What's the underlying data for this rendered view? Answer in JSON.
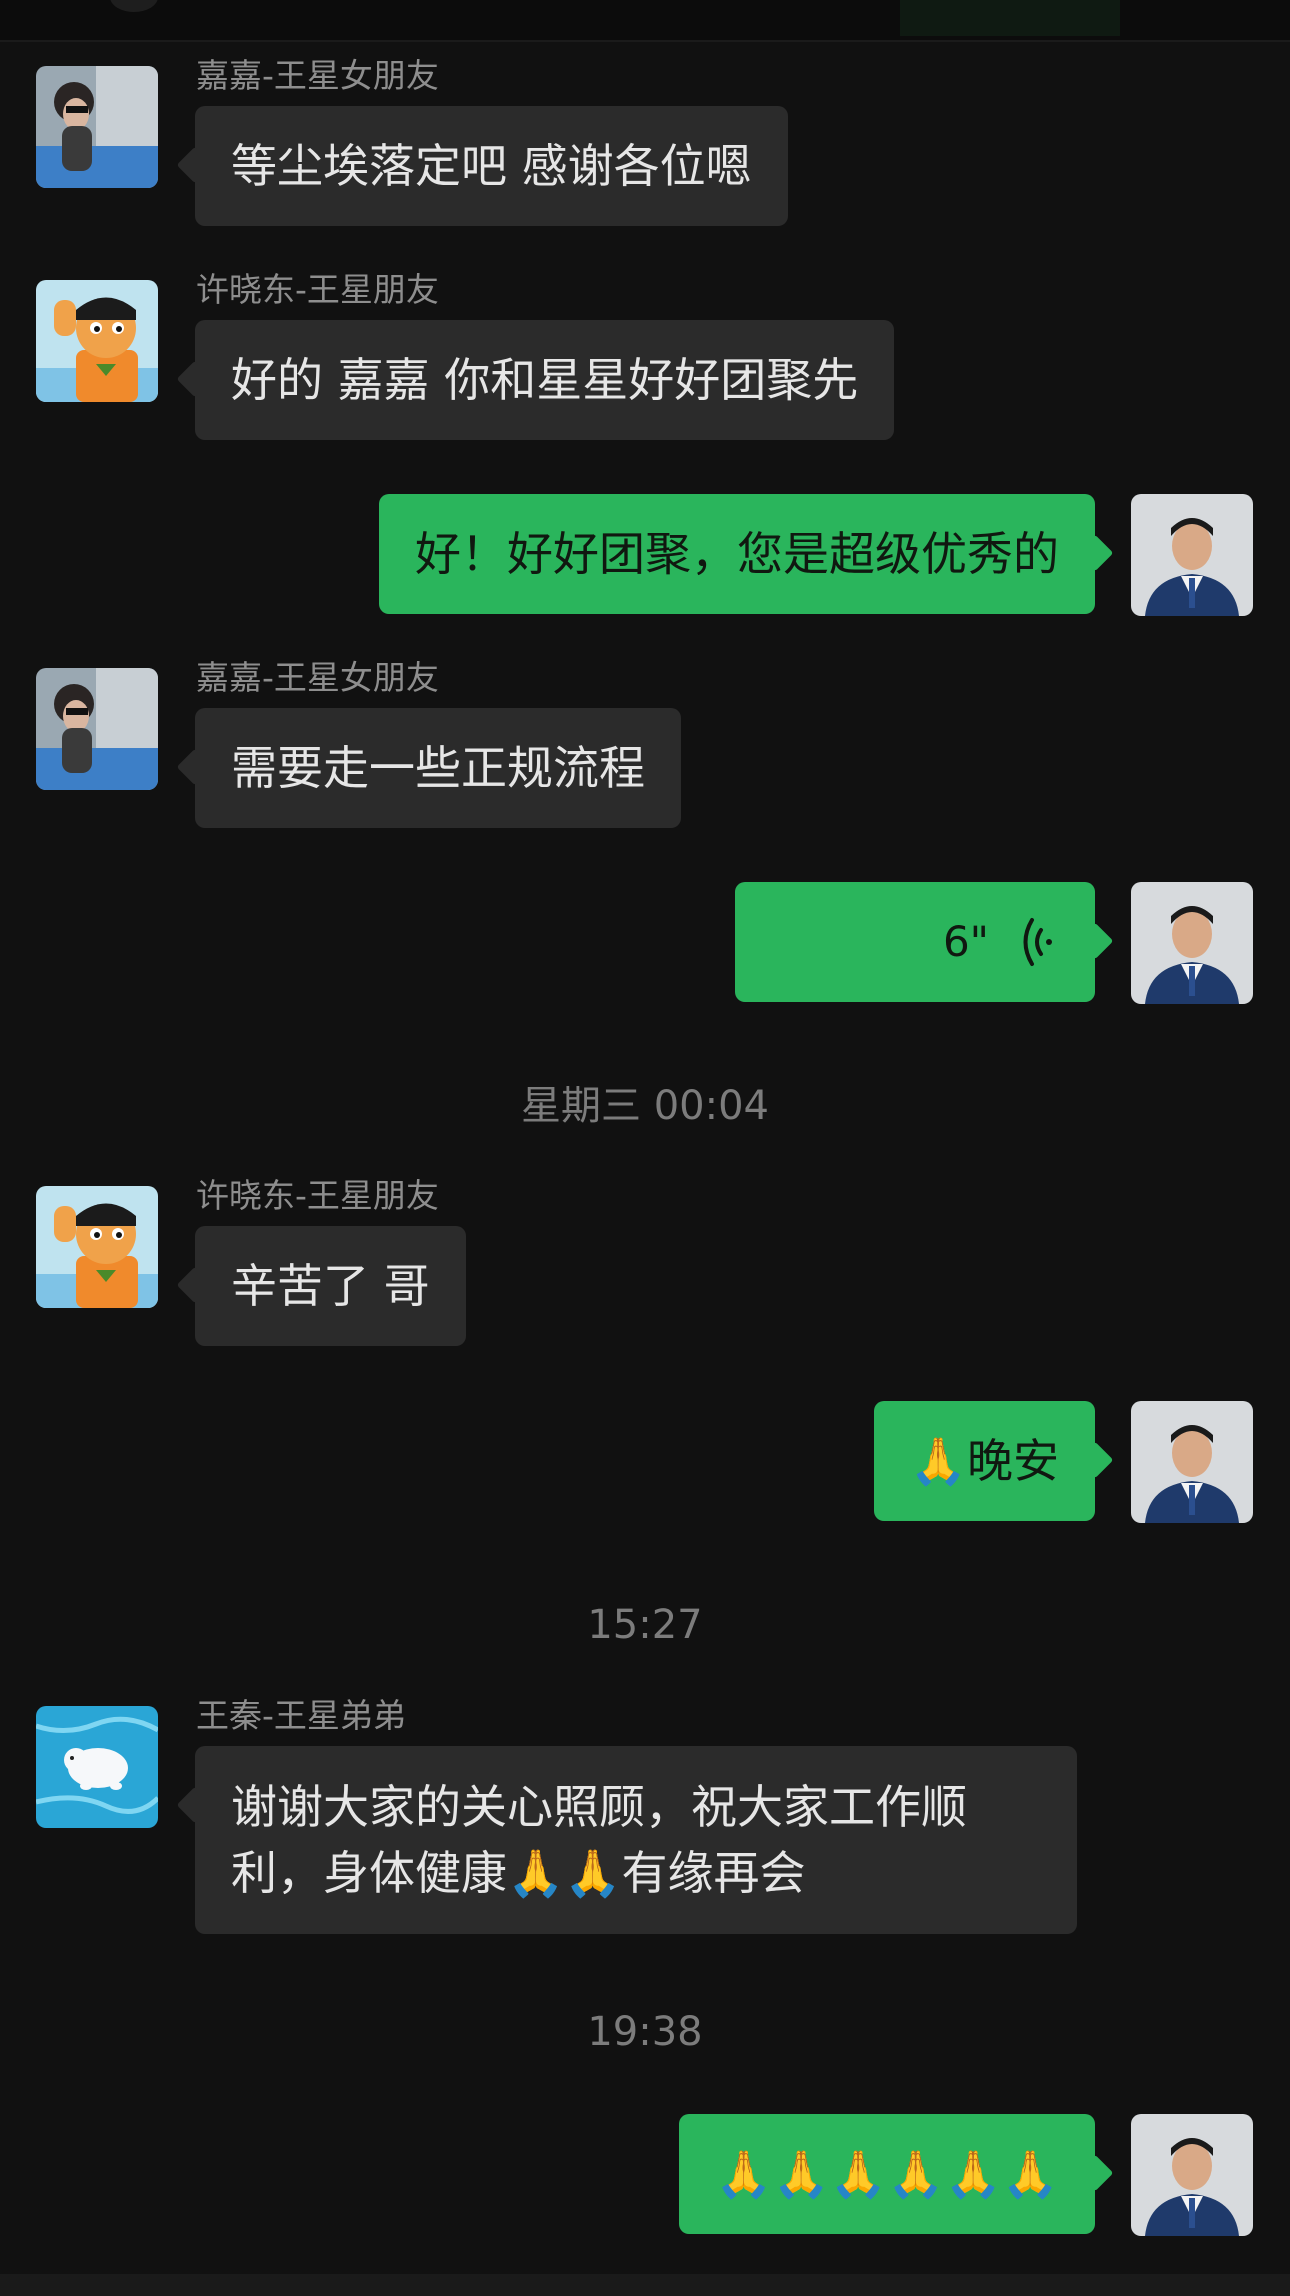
{
  "messages": [
    {
      "side": "in",
      "sender": "嘉嘉-王星女朋友",
      "text": "等尘埃落定吧 感谢各位嗯",
      "avatar": "jiajia-avatar"
    },
    {
      "side": "in",
      "sender": "许晓东-王星朋友",
      "text": "好的 嘉嘉 你和星星好好团聚先",
      "avatar": "cartoon-boy-avatar"
    },
    {
      "side": "out",
      "text": "好！好好团聚，您是超级优秀的",
      "avatar": "suit-man-avatar"
    },
    {
      "side": "in",
      "sender": "嘉嘉-王星女朋友",
      "text": "需要走一些正规流程",
      "avatar": "jiajia-avatar"
    },
    {
      "side": "out",
      "type": "voice",
      "duration": "6\"",
      "avatar": "suit-man-avatar"
    },
    {
      "type": "time",
      "text": "星期三 00:04"
    },
    {
      "side": "in",
      "sender": "许晓东-王星朋友",
      "text": "辛苦了 哥",
      "avatar": "cartoon-boy-avatar"
    },
    {
      "side": "out",
      "text": "🙏晚安",
      "avatar": "suit-man-avatar"
    },
    {
      "type": "time",
      "text": "15:27"
    },
    {
      "side": "in",
      "sender": "王秦-王星弟弟",
      "text": "谢谢大家的关心照顾，祝大家工作顺利，身体健康🙏🙏有缘再会",
      "avatar": "polar-bear-avatar"
    },
    {
      "type": "time",
      "text": "19:38"
    },
    {
      "side": "out",
      "text": "🙏🙏🙏🙏🙏🙏",
      "avatar": "suit-man-avatar"
    }
  ],
  "colors": {
    "background": "#111111",
    "incoming_bubble": "#2b2b2b",
    "outgoing_bubble": "#2ab55c",
    "sender_name": "#8e8e8e",
    "timestamp": "#7c7c7c"
  },
  "icons": {
    "voice": "voice-wave-icon",
    "emoji": "praying-hands-emoji"
  }
}
